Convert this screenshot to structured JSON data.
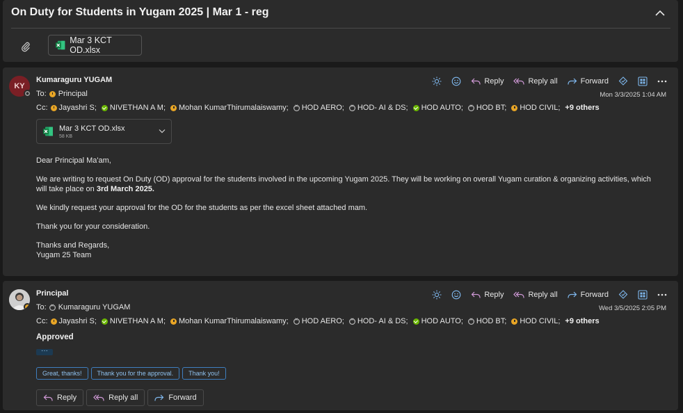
{
  "thread": {
    "title": "On Duty for Students in Yugam 2025 | Mar 1 - reg",
    "attachment_name": "Mar 3 KCT OD.xlsx"
  },
  "actions": {
    "reply": "Reply",
    "reply_all": "Reply all",
    "forward": "Forward"
  },
  "colors": {
    "accent": "#3f7fc0",
    "away": "#e8a525",
    "available": "#6bb700",
    "avatar_ky": "#7a1f25"
  },
  "messages": [
    {
      "avatar_initials": "KY",
      "sender": "Kumaraguru YUGAM",
      "to_label": "To:",
      "to": "Principal",
      "date": "Mon 3/3/2025 1:04 AM",
      "cc_label": "Cc:",
      "cc": [
        {
          "name": "Jayashri S;",
          "status": "away"
        },
        {
          "name": "NIVETHAN A M;",
          "status": "available"
        },
        {
          "name": "Mohan KumarThirumalaiswamy;",
          "status": "away"
        },
        {
          "name": "HOD AERO;",
          "status": "offline"
        },
        {
          "name": "HOD- AI & DS;",
          "status": "offline"
        },
        {
          "name": "HOD AUTO;",
          "status": "available"
        },
        {
          "name": "HOD BT;",
          "status": "offline"
        },
        {
          "name": "HOD CIVIL;",
          "status": "away"
        }
      ],
      "cc_more": "+9 others",
      "attachment": {
        "name": "Mar 3 KCT OD.xlsx",
        "size": "58 KB"
      },
      "body": {
        "greeting": "Dear Principal Ma'am,",
        "para1": "We are writing to request On Duty (OD) approval for the students involved in the upcoming Yugam 2025. They will be working on overall Yugam curation & organizing activities, which will take place on ",
        "para1_bold": "3rd March 2025.",
        "para2": "We kindly request your approval for the OD for the students as per the excel sheet attached mam.",
        "para3": "Thank you for your consideration.",
        "sign1": "Thanks and Regards,",
        "sign2": "Yugam 25 Team"
      }
    },
    {
      "sender": "Principal",
      "to_label": "To:",
      "to": "Kumaraguru YUGAM",
      "date": "Wed 3/5/2025 2:05 PM",
      "cc_label": "Cc:",
      "cc": [
        {
          "name": "Jayashri S;",
          "status": "away"
        },
        {
          "name": "NIVETHAN A M;",
          "status": "available"
        },
        {
          "name": "Mohan KumarThirumalaiswamy;",
          "status": "away"
        },
        {
          "name": "HOD AERO;",
          "status": "offline"
        },
        {
          "name": "HOD- AI & DS;",
          "status": "offline"
        },
        {
          "name": "HOD AUTO;",
          "status": "available"
        },
        {
          "name": "HOD BT;",
          "status": "offline"
        },
        {
          "name": "HOD CIVIL;",
          "status": "away"
        }
      ],
      "cc_more": "+9 others",
      "body": "Approved",
      "ellipsis": "···",
      "suggestions": [
        "Great, thanks!",
        "Thank you for the approval.",
        "Thank you!"
      ]
    }
  ]
}
